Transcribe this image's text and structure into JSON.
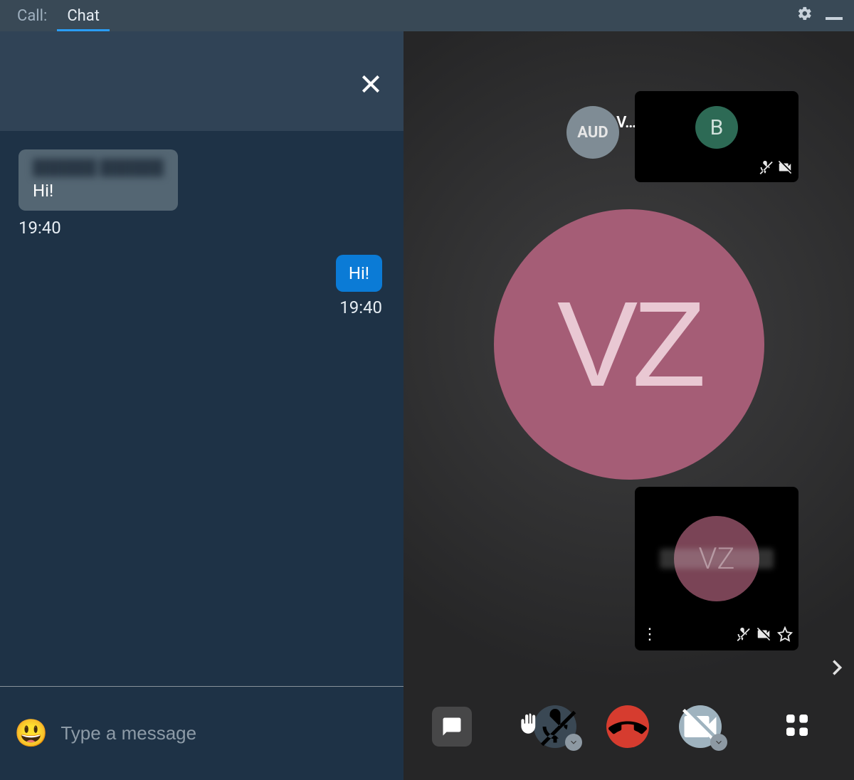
{
  "topbar": {
    "call_label": "Call:",
    "chat_label": "Chat"
  },
  "chat": {
    "messages": {
      "incoming": {
        "sender_redacted": "██████ ██████",
        "text": "Hi!",
        "time": "19:40"
      },
      "outgoing": {
        "text": "Hi!",
        "time": "19:40"
      }
    },
    "composer_placeholder": "Type a message",
    "emoji_icon": "😃"
  },
  "call": {
    "main_avatar_initials": "VZ",
    "thumb_aud_label": "AUD",
    "thumb_v_label": "V…",
    "thumb_b_initial": "B",
    "self_thumb_initials": "VZ",
    "self_more_icon": "⋮"
  }
}
